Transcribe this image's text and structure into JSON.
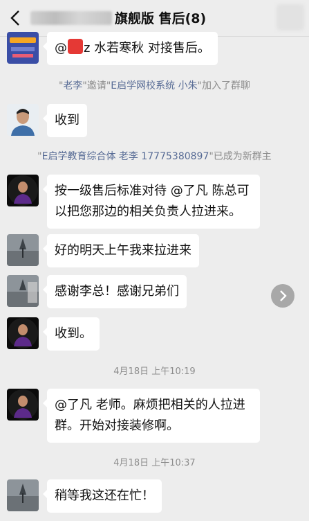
{
  "header": {
    "title": "旗舰版 售后(8)"
  },
  "messages": {
    "m0": {
      "prefix": "@",
      "name_suffix": "z 水若寒秋 对接售后。"
    },
    "m1": {
      "text": "收到"
    },
    "m2": {
      "text": "按一级售后标准对待 @了凡 陈总可以把您那边的相关负责人拉进来。"
    },
    "m3": {
      "text": "好的明天上午我来拉进来"
    },
    "m4": {
      "text": "感谢李总！感谢兄弟们"
    },
    "m5": {
      "text": "收到。"
    },
    "m6": {
      "text": "@了凡 老师。麻烦把相关的人拉进群。开始对接装修啊。"
    },
    "m7": {
      "text": "稍等我这还在忙！"
    }
  },
  "system": {
    "s1": {
      "q1": "\"",
      "name1": "老李",
      "mid": "\"邀请\"",
      "name2": "E启学网校系统 小朱",
      "end": "\"加入了群聊"
    },
    "s2": {
      "q1": "\"",
      "name1": "E启学教育综合体 老李 17775380897",
      "end": "\"已成为新群主"
    }
  },
  "times": {
    "t1": "4月18日 上午10:19",
    "t2": "4月18日 上午10:37"
  },
  "colors": {
    "background": "#ededed",
    "bubble": "#ffffff",
    "link": "#576b95",
    "muted": "#8c8c8c"
  }
}
